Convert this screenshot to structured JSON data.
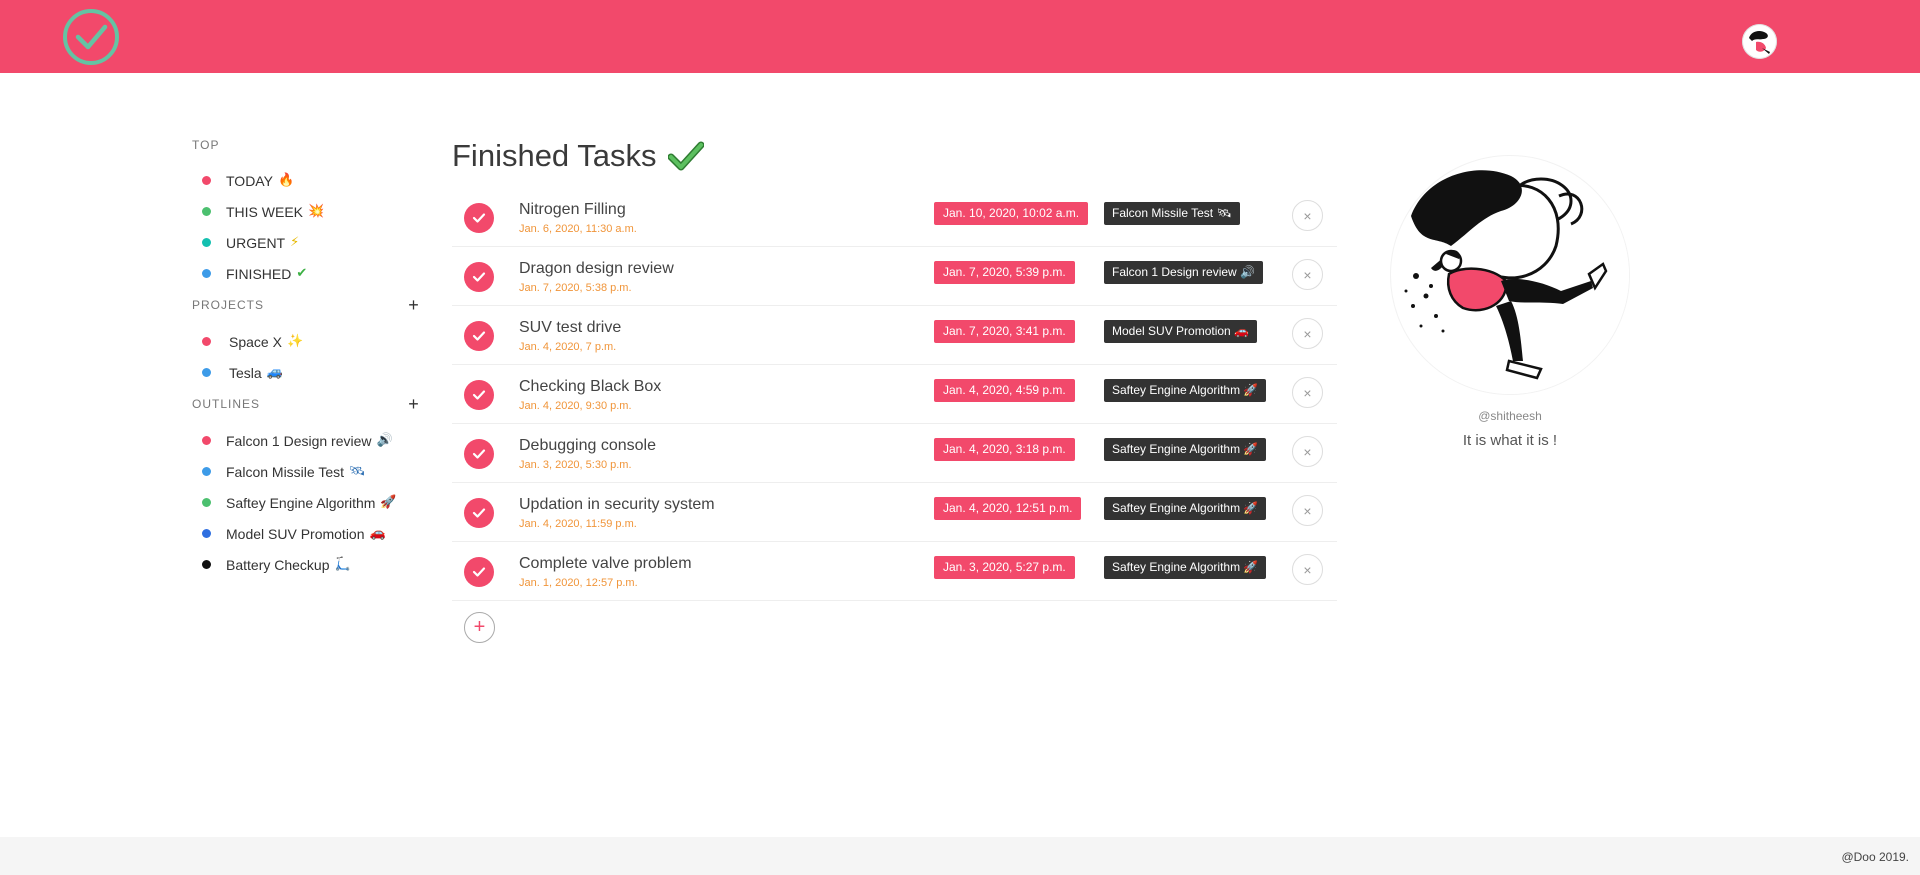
{
  "brand": {
    "accent": "#f2496b",
    "logo_ring": "#64c3a3",
    "due_color": "#f0953a"
  },
  "header": {
    "logo_icon": "check-circle-icon",
    "avatar": "user-avatar"
  },
  "sidebar": {
    "top": {
      "label": "TOP",
      "items": [
        {
          "label": "TODAY",
          "emoji": "🔥",
          "dot": "#f2496b"
        },
        {
          "label": "THIS WEEK",
          "emoji": "💥",
          "dot": "#4cc06f"
        },
        {
          "label": "URGENT",
          "emoji": "⚡",
          "dot": "#14c0b0"
        },
        {
          "label": "FINISHED",
          "emoji": "✔",
          "dot": "#3d9be8"
        }
      ]
    },
    "projects": {
      "label": "PROJECTS",
      "add": "+",
      "items": [
        {
          "label": "Space X",
          "emoji": "✨",
          "dot": "#f2496b"
        },
        {
          "label": "Tesla",
          "emoji": "🚙",
          "dot": "#3d9be8"
        }
      ]
    },
    "outlines": {
      "label": "OUTLINES",
      "add": "+",
      "items": [
        {
          "label": "Falcon 1 Design review",
          "emoji": "🔊",
          "dot": "#f2496b"
        },
        {
          "label": "Falcon Missile Test",
          "emoji": "🛰",
          "dot": "#3d9be8"
        },
        {
          "label": "Saftey Engine Algorithm",
          "emoji": "🚀",
          "dot": "#4cc06f"
        },
        {
          "label": "Model SUV Promotion",
          "emoji": "🚗",
          "dot": "#2f6fe0"
        },
        {
          "label": "Battery Checkup",
          "emoji": "🛴",
          "dot": "#111111"
        }
      ]
    }
  },
  "main": {
    "title": "Finished Tasks",
    "tasks": [
      {
        "name": "Nitrogen Filling",
        "created": "Jan. 6, 2020, 11:30 a.m.",
        "due": "Jan. 10, 2020, 10:02 a.m.",
        "project": "Falcon Missile Test 🛰"
      },
      {
        "name": "Dragon design review",
        "created": "Jan. 7, 2020, 5:38 p.m.",
        "due": "Jan. 7, 2020, 5:39 p.m.",
        "project": "Falcon 1 Design review 🔊"
      },
      {
        "name": "SUV test drive",
        "created": "Jan. 4, 2020, 7 p.m.",
        "due": "Jan. 7, 2020, 3:41 p.m.",
        "project": "Model SUV Promotion 🚗"
      },
      {
        "name": "Checking Black Box",
        "created": "Jan. 4, 2020, 9:30 p.m.",
        "due": "Jan. 4, 2020, 4:59 p.m.",
        "project": "Saftey Engine Algorithm 🚀"
      },
      {
        "name": "Debugging console",
        "created": "Jan. 3, 2020, 5:30 p.m.",
        "due": "Jan. 4, 2020, 3:18 p.m.",
        "project": "Saftey Engine Algorithm 🚀"
      },
      {
        "name": "Updation in security system",
        "created": "Jan. 4, 2020, 11:59 p.m.",
        "due": "Jan. 4, 2020, 12:51 p.m.",
        "project": "Saftey Engine Algorithm 🚀"
      },
      {
        "name": "Complete valve problem",
        "created": "Jan. 1, 2020, 12:57 p.m.",
        "due": "Jan. 3, 2020, 5:27 p.m.",
        "project": "Saftey Engine Algorithm 🚀"
      }
    ],
    "add_task": "+",
    "delete_glyph": "×"
  },
  "profile": {
    "handle": "@shitheesh",
    "bio": "It is what it is !"
  },
  "footer": {
    "text": "@Doo 2019."
  }
}
